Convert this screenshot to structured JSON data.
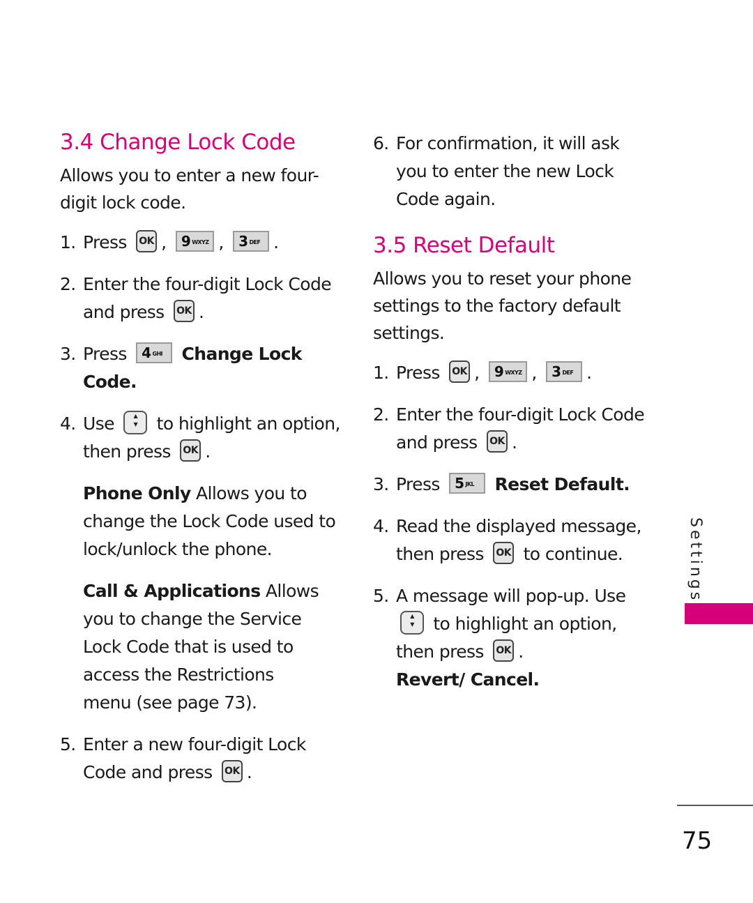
{
  "section_34": {
    "title": "3.4 Change Lock Code",
    "intro": "Allows you to enter a new four-digit lock code.",
    "steps": [
      {
        "num": "1.",
        "text": "Press",
        "keys": [
          "OK",
          "9",
          "3"
        ]
      },
      {
        "num": "2.",
        "text": "Enter the four-digit Lock Code and press",
        "end": "."
      },
      {
        "num": "3.",
        "text": "Press",
        "key": {
          "digit": "4",
          "letters": "GHI"
        },
        "bold": "Change Lock Code."
      },
      {
        "num": "4.",
        "text_a": "Use",
        "text_b": "to highlight an option, then press",
        "end": "."
      },
      {
        "num": "5.",
        "text": "Enter a new four-digit Lock Code and press",
        "end": "."
      }
    ],
    "options": [
      {
        "label": "Phone Only",
        "desc": "Allows you to change the Lock Code used to lock/unlock the phone."
      },
      {
        "label": "Call & Applications",
        "desc": "Allows you to change the Service Lock Code that is used to access the Restrictions menu (see page 73)."
      }
    ],
    "step6": {
      "num": "6.",
      "text": "For confirmation, it will ask you to enter the new Lock Code again."
    }
  },
  "section_35": {
    "title": "3.5 Reset Default",
    "intro": "Allows you to reset your phone settings to the factory default settings.",
    "steps": [
      {
        "num": "1.",
        "text": "Press"
      },
      {
        "num": "2.",
        "text": "Enter the four-digit Lock Code and press",
        "end": "."
      },
      {
        "num": "3.",
        "text": "Press",
        "key": {
          "digit": "5",
          "letters": "JKL"
        },
        "bold": "Reset Default."
      },
      {
        "num": "4.",
        "text_a": "Read the displayed message, then press",
        "text_b": "to continue."
      },
      {
        "num": "5.",
        "text_a": "A message will pop-up. Use",
        "text_b": "to highlight an option, then press",
        "end": ".",
        "bold": "Revert/ Cancel."
      }
    ]
  },
  "keys": {
    "ok": "OK",
    "nine": {
      "digit": "9",
      "letters": "WXYZ"
    },
    "three": {
      "digit": "3",
      "letters": "DEF"
    },
    "nav_up": "▲",
    "nav_down": "▼"
  },
  "punct": {
    "comma": ",",
    "period": "."
  },
  "side_tab": {
    "label": "Settings",
    "color": "#d6007a"
  },
  "page_number": "75",
  "accent_color": "#d6007a"
}
